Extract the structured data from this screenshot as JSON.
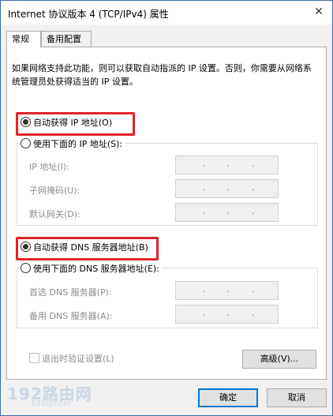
{
  "window": {
    "title": "Internet 协议版本 4 (TCP/IPv4) 属性",
    "close_glyph": "✕"
  },
  "tabs": [
    {
      "label": "常规"
    },
    {
      "label": "备用配置"
    }
  ],
  "description": "如果网络支持此功能，则可以获取自动指派的 IP 设置。否则，你需要从网络系统管理员处获得适当的 IP 设置。",
  "ip": {
    "auto_label": "自动获得 IP 地址(O)",
    "manual_label": "使用下面的 IP 地址(S):",
    "selected": "auto",
    "fields": [
      {
        "label": "IP 地址(I):",
        "value": ". . ."
      },
      {
        "label": "子网掩码(U):",
        "value": ". . ."
      },
      {
        "label": "默认网关(D):",
        "value": ". . ."
      }
    ]
  },
  "dns": {
    "auto_label": "自动获得 DNS 服务器地址(B)",
    "manual_label": "使用下面的 DNS 服务器地址(E):",
    "selected": "auto",
    "fields": [
      {
        "label": "首选 DNS 服务器(P):",
        "value": ". . ."
      },
      {
        "label": "备用 DNS 服务器(A):",
        "value": ". . ."
      }
    ]
  },
  "validate_label": "退出时验证设置(L)",
  "advanced_label": "高级(V)...",
  "ok_label": "确定",
  "cancel_label": "取消",
  "watermark": {
    "main": "192路由网",
    "sub": "192ly.com"
  },
  "colors": {
    "highlight": "#e0242b",
    "default_button_border": "#0078d7"
  }
}
